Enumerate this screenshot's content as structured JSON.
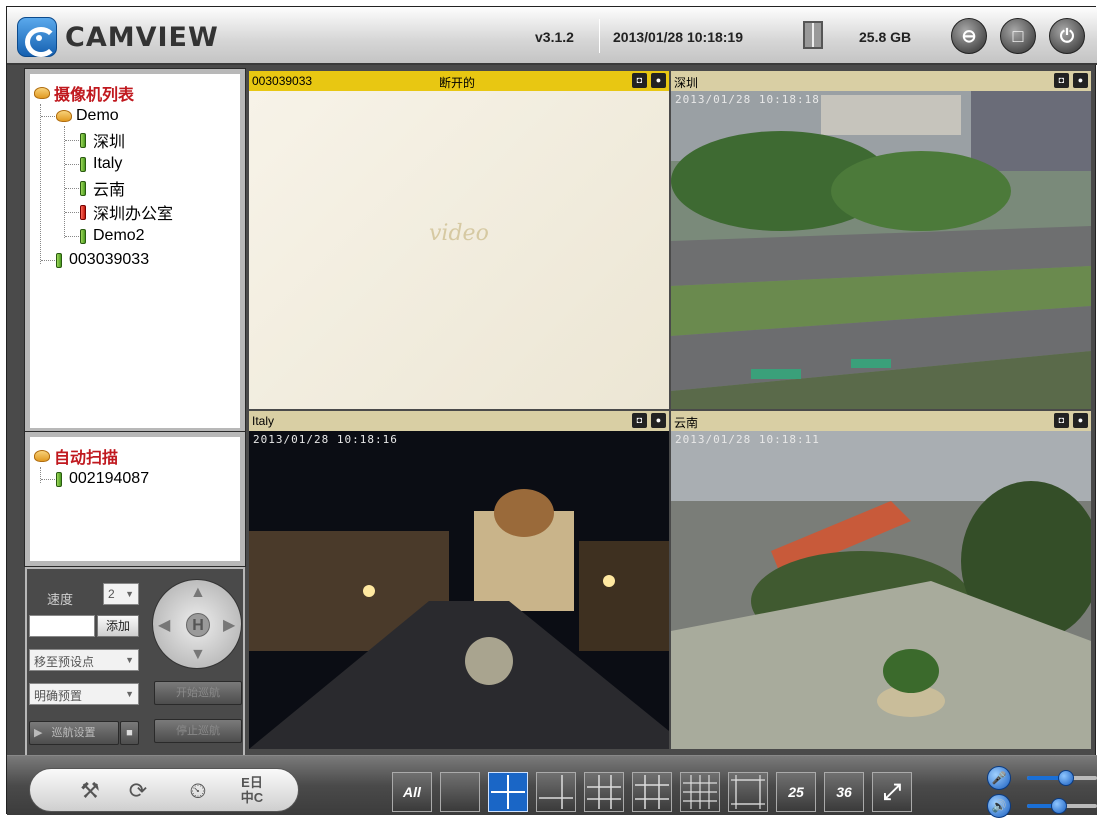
{
  "header": {
    "brand": "CAMVIEW",
    "version": "v3.1.2",
    "datetime": "2013/01/28 10:18:19",
    "disk_free": "25.8 GB"
  },
  "camera_list": {
    "root_label": "摄像机列表",
    "group_label": "Demo",
    "group_items": [
      "深圳",
      "Italy",
      "云南",
      "深圳办公室",
      "Demo2"
    ],
    "ungrouped": "003039033"
  },
  "auto_scan": {
    "root_label": "自动扫描",
    "items": [
      "002194087"
    ]
  },
  "ptz": {
    "speed_label": "速度",
    "speed_value": "2",
    "add_label": "添加",
    "goto_preset": "移至预设点",
    "clear_preset": "明确预置",
    "cruise_label": "巡航设置",
    "dark_btn_1": "开始巡航",
    "dark_btn_2": "停止巡航"
  },
  "videos": [
    {
      "name": "003039033",
      "status": "断开的",
      "timestamp": "",
      "connected": false,
      "watermark": "video"
    },
    {
      "name": "深圳",
      "status": "",
      "timestamp": "2013/01/28 10:18:18",
      "connected": true
    },
    {
      "name": "Italy",
      "status": "",
      "timestamp": "2013/01/28 10:18:16",
      "connected": true
    },
    {
      "name": "云南",
      "status": "",
      "timestamp": "2013/01/28 10:18:11",
      "connected": true
    }
  ],
  "toolbar": {
    "layouts": [
      "All",
      "1",
      "4",
      "6",
      "8",
      "9",
      "13",
      "16",
      "25",
      "36",
      "fullscreen"
    ],
    "layout_labels": {
      "all": "All",
      "l25": "25",
      "l36": "36"
    },
    "tool_chinese_label": "中C",
    "tool_chinese_top": "E日",
    "active_layout": "4",
    "volume_level": 0.45,
    "mic_level": 0.55
  },
  "colors": {
    "active_bar": "#e8c712",
    "accent_blue": "#1a66c6",
    "tree_root": "#c0181e"
  }
}
